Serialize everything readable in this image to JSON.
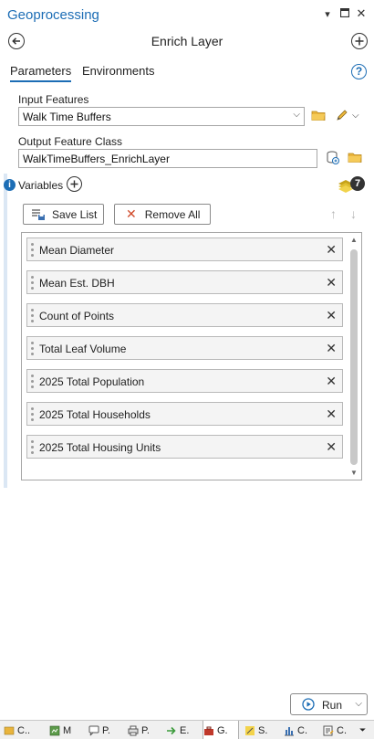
{
  "window": {
    "title": "Geoprocessing"
  },
  "tool": {
    "name": "Enrich Layer"
  },
  "tabs": [
    {
      "label": "Parameters"
    },
    {
      "label": "Environments"
    }
  ],
  "help": {
    "label": "?"
  },
  "input_features": {
    "label": "Input Features",
    "value": "Walk Time Buffers"
  },
  "output_class": {
    "label": "Output Feature Class",
    "value": "WalkTimeBuffers_EnrichLayer"
  },
  "variables": {
    "label": "Variables",
    "count": "7"
  },
  "buttons": {
    "save_list": "Save List",
    "remove_all": "Remove All"
  },
  "variable_items": [
    "Mean Diameter",
    "Mean Est. DBH",
    "Count of Points",
    "Total Leaf Volume",
    "2025 Total Population",
    "2025 Total Households",
    "2025 Total Housing Units"
  ],
  "run": {
    "label": "Run"
  },
  "bottom_tabs": [
    {
      "label": "C..",
      "icon": "catalog-icon"
    },
    {
      "label": "M",
      "icon": "map-icon"
    },
    {
      "label": "P.",
      "icon": "popup-icon"
    },
    {
      "label": "P.",
      "icon": "print-icon"
    },
    {
      "label": "E.",
      "icon": "export-icon"
    },
    {
      "label": "G.",
      "icon": "toolbox-icon"
    },
    {
      "label": "S.",
      "icon": "symbology-icon"
    },
    {
      "label": "C.",
      "icon": "chart-icon"
    },
    {
      "label": "C.",
      "icon": "contents-icon"
    }
  ],
  "colors": {
    "accent": "#1c6db5",
    "border": "#a6a6a6",
    "row_bg": "#f4f4f4"
  }
}
